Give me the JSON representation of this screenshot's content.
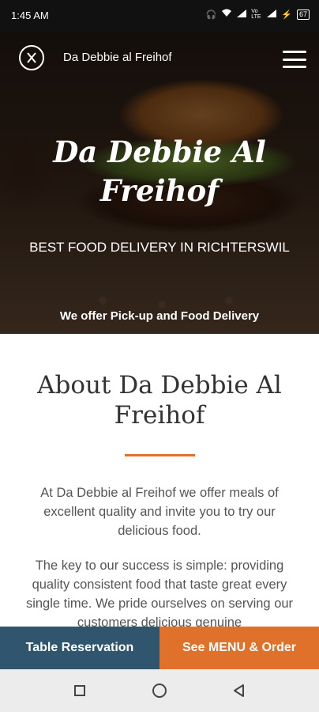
{
  "status_bar": {
    "time": "1:45 AM",
    "network": "Vo LTE",
    "battery": "67"
  },
  "header": {
    "brand": "Da Debbie al Freihof",
    "logo_icon": "fork-knife-icon",
    "menu_icon": "hamburger-menu-icon"
  },
  "hero": {
    "title_line1": "Da Debbie Al",
    "title_line2": "Freihof",
    "subtitle": "BEST FOOD DELIVERY IN RICHTERSWIL",
    "note": "We offer Pick-up and Food Delivery"
  },
  "about": {
    "title_line1": "About Da Debbie Al",
    "title_line2": "Freihof",
    "paragraph1": "At Da Debbie al Freihof we offer meals of excellent quality and invite you to try our delicious food.",
    "paragraph2": "The key to our success is simple: providing quality consistent food that taste great every single time. We pride ourselves on serving our customers delicious genuine"
  },
  "actions": {
    "reservation_label": "Table Reservation",
    "menu_label": "See MENU & Order"
  },
  "colors": {
    "accent": "#e0712a",
    "primary": "#2f556f"
  }
}
